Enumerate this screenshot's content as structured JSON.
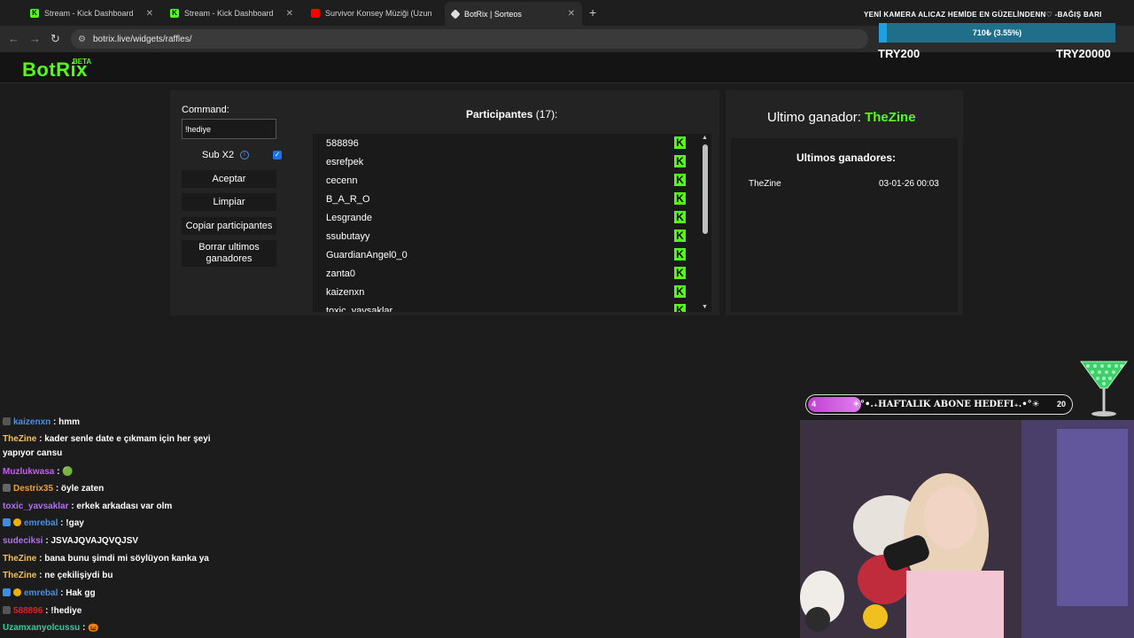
{
  "browser": {
    "tabs": [
      {
        "title": "Stream - Kick Dashboard",
        "favicon": "kick-icon"
      },
      {
        "title": "Stream - Kick Dashboard",
        "favicon": "kick-icon"
      },
      {
        "title": "Survivor Konsey Müziği (Uzun V",
        "favicon": "youtube-icon"
      },
      {
        "title": "BotRix | Sorteos",
        "favicon": "botrix-icon"
      }
    ],
    "active_tab": 3,
    "new_tab": "+",
    "close_glyph": "✕",
    "url": "botrix.live/widgets/raffles/"
  },
  "app": {
    "logo": "BotRix",
    "beta": "BETA"
  },
  "raffle": {
    "command_label": "Command:",
    "command_value": "!hediye",
    "sub_label": "Sub X2",
    "sub_checked": true,
    "buttons": {
      "accept": "Aceptar",
      "clear": "Limpiar",
      "copy": "Copiar participantes",
      "delete": "Borrar ultimos ganadores"
    },
    "participants_title": "Participantes",
    "participants_count": "(17):",
    "participants": [
      "588896",
      "esrefpek",
      "cecenn",
      "B_A_R_O",
      "Lesgrande",
      "ssubutayy",
      "GuardianAngel0_0",
      "zanta0",
      "kaizenxn",
      "toxic_yavsaklar"
    ],
    "platform_badge": "K"
  },
  "winners": {
    "last_winner_label": "Ultimo ganador:",
    "last_winner": "TheZine",
    "recent_title": "Ultimos ganadores:",
    "recent": [
      {
        "name": "TheZine",
        "date": "03-01-26 00:03"
      }
    ]
  },
  "overlay": {
    "donation_title": "YENİ KAMERA ALICAZ HEMİDE EN GÜZELİNDENN♡ -BAĞIŞ BARI",
    "donation_progress": "710₺ (3.55%)",
    "donation_fraction": 0.0355,
    "donation_min": "TRY200",
    "donation_max": "TRY20000",
    "sub_goal_title": "☀°•.₊HAFTALIK ABONE HEDEFI₊.•°☀",
    "sub_goal_current": "4",
    "sub_goal_max": "20",
    "sub_goal_fraction": 0.2
  },
  "chat": [
    {
      "user": "kaizenxn",
      "color": "#4a90e2",
      "msg": ": hmm",
      "badge": true
    },
    {
      "user": "TheZine",
      "color": "#f0c060",
      "msg": ": kader senle date e çıkmam için her şeyi yapıyor cansu",
      "wrap": true
    },
    {
      "user": "Muzlukwasa",
      "color": "#c060f0",
      "msg": ": 🟢"
    },
    {
      "user": "Destrix35",
      "color": "#f0a030",
      "msg": ": öyle zaten",
      "badge": true
    },
    {
      "user": "toxic_yavsaklar",
      "color": "#b070f0",
      "msg": ": erkek arkadası var olm"
    },
    {
      "user": "emrebal",
      "color": "#4a90e2",
      "msg": ": !gay",
      "badge": true
    },
    {
      "user": "sudeciksi",
      "color": "#b070f0",
      "msg": ": JSVAJQVAJQVQJSV"
    },
    {
      "user": "TheZine",
      "color": "#f0c060",
      "msg": ": bana bunu şimdi mi söylüyon kanka ya"
    },
    {
      "user": "TheZine",
      "color": "#f0c060",
      "msg": ": ne çekilişiydi bu"
    },
    {
      "user": "emrebal",
      "color": "#4a90e2",
      "msg": ": Hak gg",
      "badge": true
    },
    {
      "user": "588896",
      "color": "#e02020",
      "msg": ": !hediye",
      "badge": true
    },
    {
      "user": "Uzamxanyolcussu",
      "color": "#30d0a0",
      "msg": ": 🎃"
    }
  ]
}
